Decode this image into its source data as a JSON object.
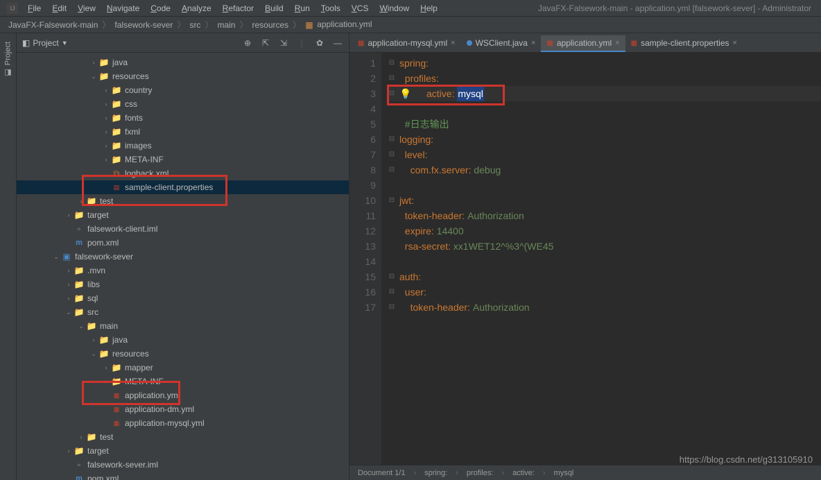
{
  "window": {
    "title": "JavaFX-Falsework-main - application.yml [falsework-sever] - Administrator"
  },
  "menu": [
    "File",
    "Edit",
    "View",
    "Navigate",
    "Code",
    "Analyze",
    "Refactor",
    "Build",
    "Run",
    "Tools",
    "VCS",
    "Window",
    "Help"
  ],
  "breadcrumb": [
    "JavaFX-Falsework-main",
    "falsework-sever",
    "src",
    "main",
    "resources",
    "application.yml"
  ],
  "panel": {
    "title": "Project"
  },
  "tree": [
    {
      "d": 3,
      "a": ">",
      "t": "folder-src",
      "l": "java"
    },
    {
      "d": 3,
      "a": "v",
      "t": "folder-src",
      "l": "resources"
    },
    {
      "d": 4,
      "a": ">",
      "t": "folder",
      "l": "country"
    },
    {
      "d": 4,
      "a": ">",
      "t": "folder",
      "l": "css"
    },
    {
      "d": 4,
      "a": ">",
      "t": "folder",
      "l": "fonts"
    },
    {
      "d": 4,
      "a": ">",
      "t": "folder",
      "l": "fxml"
    },
    {
      "d": 4,
      "a": ">",
      "t": "folder",
      "l": "images"
    },
    {
      "d": 4,
      "a": ">",
      "t": "folder",
      "l": "META-INF"
    },
    {
      "d": 4,
      "a": "",
      "t": "xml",
      "l": "logback.xml"
    },
    {
      "d": 4,
      "a": "",
      "t": "prop",
      "l": "sample-client.properties",
      "sel": true
    },
    {
      "d": 2,
      "a": ">",
      "t": "folder",
      "l": "test"
    },
    {
      "d": 1,
      "a": ">",
      "t": "folder-src",
      "l": "target"
    },
    {
      "d": 1,
      "a": "",
      "t": "file",
      "l": "falsework-client.iml"
    },
    {
      "d": 1,
      "a": "",
      "t": "maven",
      "l": "pom.xml"
    },
    {
      "d": 0,
      "a": "v",
      "t": "module",
      "l": "falsework-sever"
    },
    {
      "d": 1,
      "a": ">",
      "t": "folder",
      "l": ".mvn"
    },
    {
      "d": 1,
      "a": ">",
      "t": "folder",
      "l": "libs"
    },
    {
      "d": 1,
      "a": ">",
      "t": "folder",
      "l": "sql"
    },
    {
      "d": 1,
      "a": "v",
      "t": "folder",
      "l": "src"
    },
    {
      "d": 2,
      "a": "v",
      "t": "folder",
      "l": "main"
    },
    {
      "d": 3,
      "a": ">",
      "t": "folder-src",
      "l": "java"
    },
    {
      "d": 3,
      "a": "v",
      "t": "folder-src",
      "l": "resources"
    },
    {
      "d": 4,
      "a": ">",
      "t": "folder",
      "l": "mapper"
    },
    {
      "d": 4,
      "a": ">",
      "t": "folder",
      "l": "META-INF"
    },
    {
      "d": 4,
      "a": "",
      "t": "yml",
      "l": "application.yml"
    },
    {
      "d": 4,
      "a": "",
      "t": "yml",
      "l": "application-dm.yml"
    },
    {
      "d": 4,
      "a": "",
      "t": "yml",
      "l": "application-mysql.yml"
    },
    {
      "d": 2,
      "a": ">",
      "t": "folder",
      "l": "test"
    },
    {
      "d": 1,
      "a": ">",
      "t": "folder-src",
      "l": "target"
    },
    {
      "d": 1,
      "a": "",
      "t": "file",
      "l": "falsework-sever.iml"
    },
    {
      "d": 1,
      "a": "",
      "t": "maven",
      "l": "pom.xml"
    }
  ],
  "tabs": [
    {
      "label": "application-mysql.yml",
      "icon": "yml",
      "active": false,
      "close": true
    },
    {
      "label": "WSClient.java",
      "icon": "dot",
      "active": false,
      "close": true
    },
    {
      "label": "application.yml",
      "icon": "yml",
      "active": true,
      "close": true
    },
    {
      "label": "sample-client.properties",
      "icon": "prop",
      "active": false,
      "close": true
    }
  ],
  "code": {
    "lines": [
      {
        "n": 1,
        "fold": "⊟",
        "segs": [
          [
            "k",
            "spring"
          ],
          [
            ":",
            ":"
          ]
        ]
      },
      {
        "n": 2,
        "fold": "⊟",
        "indent": "  ",
        "segs": [
          [
            "k",
            "profiles"
          ],
          [
            ":",
            ":"
          ]
        ]
      },
      {
        "n": 3,
        "fold": "⊟",
        "indent": "    ",
        "bulb": true,
        "segs": [
          [
            "k",
            "active"
          ],
          [
            ":",
            ": "
          ],
          [
            "sel",
            "mysql"
          ]
        ],
        "hl": true
      },
      {
        "n": 4,
        "fold": "",
        "segs": []
      },
      {
        "n": 5,
        "fold": "",
        "indent": "  ",
        "segs": [
          [
            "c",
            "#日志输出"
          ]
        ]
      },
      {
        "n": 6,
        "fold": "⊟",
        "segs": [
          [
            "k",
            "logging"
          ],
          [
            ":",
            ":"
          ]
        ]
      },
      {
        "n": 7,
        "fold": "⊟",
        "indent": "  ",
        "segs": [
          [
            "k",
            "level"
          ],
          [
            ":",
            ":"
          ]
        ]
      },
      {
        "n": 8,
        "fold": "⊟",
        "indent": "    ",
        "segs": [
          [
            "k",
            "com.fx.server"
          ],
          [
            ":",
            ": "
          ],
          [
            "s",
            "debug"
          ]
        ]
      },
      {
        "n": 9,
        "fold": "",
        "segs": []
      },
      {
        "n": 10,
        "fold": "⊟",
        "segs": [
          [
            "k",
            "jwt"
          ],
          [
            ":",
            ":"
          ]
        ]
      },
      {
        "n": 11,
        "fold": "",
        "indent": "  ",
        "segs": [
          [
            "k",
            "token-header"
          ],
          [
            ":",
            ": "
          ],
          [
            "s",
            "Authorization"
          ]
        ]
      },
      {
        "n": 12,
        "fold": "",
        "indent": "  ",
        "segs": [
          [
            "k",
            "expire"
          ],
          [
            ":",
            ": "
          ],
          [
            "s",
            "14400"
          ]
        ]
      },
      {
        "n": 13,
        "fold": "",
        "indent": "  ",
        "segs": [
          [
            "k",
            "rsa-secret"
          ],
          [
            ":",
            ": "
          ],
          [
            "s",
            "xx1WET12^%3^(WE45"
          ]
        ]
      },
      {
        "n": 14,
        "fold": "",
        "segs": []
      },
      {
        "n": 15,
        "fold": "⊟",
        "segs": [
          [
            "k",
            "auth"
          ],
          [
            ":",
            ":"
          ]
        ]
      },
      {
        "n": 16,
        "fold": "⊟",
        "indent": "  ",
        "segs": [
          [
            "k",
            "user"
          ],
          [
            ":",
            ":"
          ]
        ]
      },
      {
        "n": 17,
        "fold": "⊟",
        "indent": "    ",
        "segs": [
          [
            "k",
            "token-header"
          ],
          [
            ":",
            ": "
          ],
          [
            "s",
            "Authorization"
          ]
        ]
      }
    ]
  },
  "status": {
    "doc": "Document 1/1",
    "path": [
      "spring:",
      "profiles:",
      "active:",
      "mysql"
    ]
  },
  "watermark": "https://blog.csdn.net/g313105910"
}
